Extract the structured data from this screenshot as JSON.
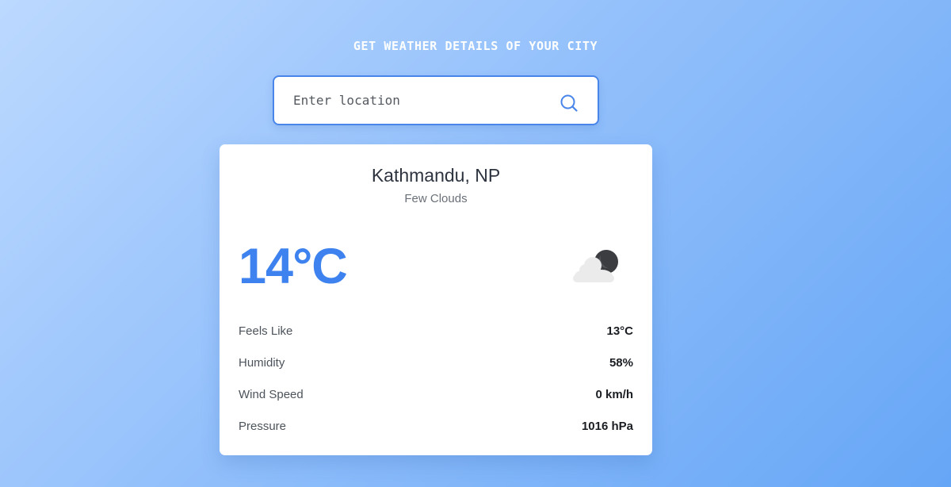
{
  "header": {
    "title": "GET WEATHER DETAILS OF YOUR CITY"
  },
  "search": {
    "placeholder": "Enter location",
    "value": "",
    "icon": "search-icon",
    "accent_color": "#4a86ea"
  },
  "weather": {
    "location": "Kathmandu, NP",
    "description": "Few Clouds",
    "temperature": "14°C",
    "icon": "few-clouds-night-icon",
    "temperature_color": "#3d82ee",
    "details": [
      {
        "label": "Feels Like",
        "value": "13°C"
      },
      {
        "label": "Humidity",
        "value": "58%"
      },
      {
        "label": "Wind Speed",
        "value": "0 km/h"
      },
      {
        "label": "Pressure",
        "value": "1016 hPa"
      }
    ]
  }
}
